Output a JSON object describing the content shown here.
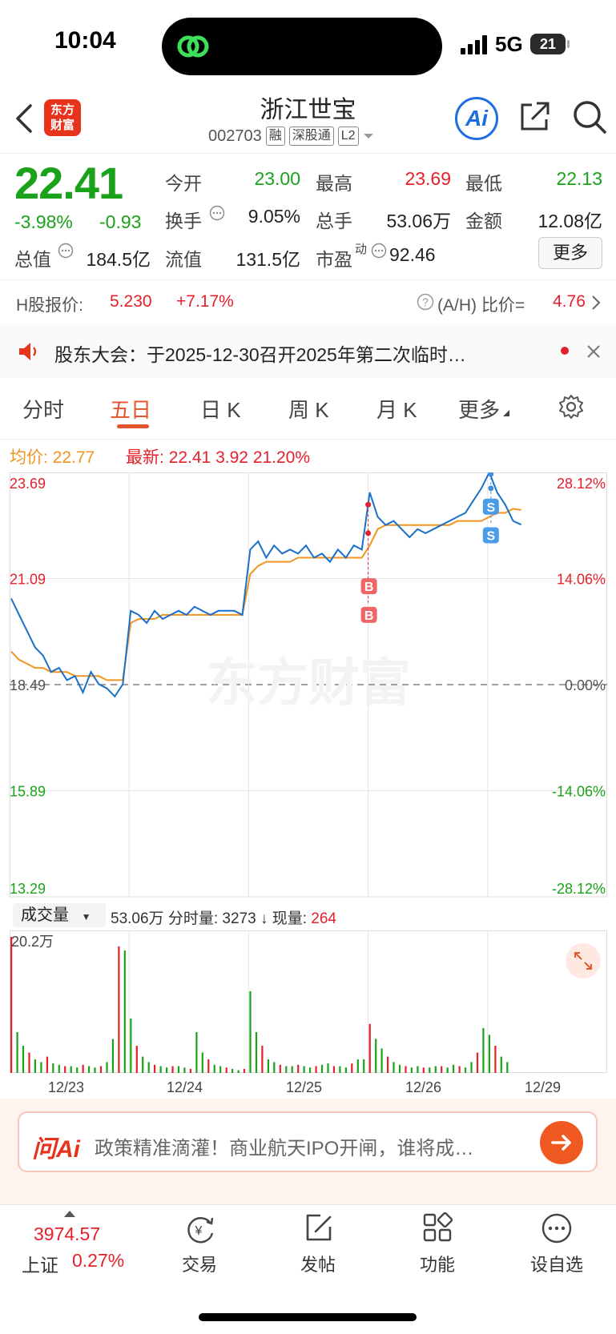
{
  "status_bar": {
    "time": "10:04",
    "network": "5G",
    "battery": "21"
  },
  "header": {
    "logo_text": "东方财富",
    "stock_name": "浙江世宝",
    "code": "002703",
    "tags": [
      "融",
      "深股通",
      "L2"
    ],
    "ai_label": "Ai"
  },
  "quote": {
    "price": "22.41",
    "change_pct": "-3.98%",
    "change_amt": "-0.93",
    "open_label": "今开",
    "open": "23.00",
    "high_label": "最高",
    "high": "23.69",
    "low_label": "最低",
    "low": "22.13",
    "turnover_label": "换手",
    "turnover": "9.05%",
    "volume_label": "总手",
    "volume": "53.06万",
    "amount_label": "金额",
    "amount": "12.08亿",
    "mcap_label": "总值",
    "mcap": "184.5亿",
    "float_label": "流值",
    "float": "131.5亿",
    "pe_label": "市盈",
    "pe_sup": "动",
    "pe": "92.46",
    "more_label": "更多"
  },
  "hshare": {
    "label": "H股报价:",
    "price": "5.230",
    "change": "+7.17%",
    "ah_label": "(A/H) 比价=",
    "ah_value": "4.76"
  },
  "notice": {
    "text": "股东大会：于2025-12-30召开2025年第二次临时…"
  },
  "tabs": [
    "分时",
    "五日",
    "日 K",
    "周 K",
    "月 K",
    "更多"
  ],
  "active_tab": "五日",
  "chart_info": {
    "avg_label": "均价:",
    "avg": "22.77",
    "latest_label": "最新:",
    "latest": "22.41",
    "latest_chg": "3.92",
    "latest_pct": "21.20%"
  },
  "chart_data": {
    "type": "line",
    "title": "",
    "left_axis": [
      "23.69",
      "21.09",
      "18.49",
      "15.89",
      "13.29"
    ],
    "right_axis": [
      "28.12%",
      "14.06%",
      "0.00%",
      "-14.06%",
      "-28.12%"
    ],
    "ylim": [
      13.29,
      23.69
    ],
    "base": 18.49,
    "days": [
      "12/23",
      "12/24",
      "12/25",
      "12/26",
      "12/29"
    ],
    "series": [
      {
        "name": "",
        "values": [
          20.6,
          20.2,
          19.8,
          19.4,
          19.2,
          18.8,
          18.9,
          18.6,
          18.7,
          18.3,
          18.8,
          18.5,
          18.4,
          18.2,
          18.5,
          20.3,
          20.2,
          20.0,
          20.3,
          20.1,
          20.2,
          20.3,
          20.2,
          20.4,
          20.3,
          20.2,
          20.3,
          20.3,
          20.3,
          20.2,
          21.8,
          22.0,
          21.6,
          21.9,
          21.7,
          21.8,
          21.7,
          21.9,
          21.6,
          21.7,
          21.5,
          21.8,
          21.6,
          21.9,
          21.8,
          23.2,
          22.6,
          22.4,
          22.5,
          22.3,
          22.1,
          22.3,
          22.2,
          22.3,
          22.4,
          22.5,
          22.6,
          22.7,
          23.0,
          23.3,
          23.69,
          23.2,
          22.9,
          22.5,
          22.41
        ]
      },
      {
        "name": "均价",
        "values": [
          19.3,
          19.1,
          19.0,
          18.9,
          18.9,
          18.8,
          18.8,
          18.8,
          18.7,
          18.7,
          18.7,
          18.7,
          18.6,
          18.6,
          18.6,
          20.0,
          20.1,
          20.1,
          20.1,
          20.2,
          20.2,
          20.2,
          20.2,
          20.2,
          20.2,
          20.2,
          20.2,
          20.2,
          20.2,
          20.2,
          21.2,
          21.4,
          21.5,
          21.5,
          21.5,
          21.5,
          21.6,
          21.6,
          21.6,
          21.6,
          21.6,
          21.6,
          21.6,
          21.6,
          21.6,
          21.9,
          22.3,
          22.4,
          22.4,
          22.4,
          22.4,
          22.4,
          22.4,
          22.4,
          22.4,
          22.4,
          22.5,
          22.5,
          22.5,
          22.5,
          22.6,
          22.7,
          22.7,
          22.8,
          22.77
        ]
      }
    ],
    "markers": [
      "B",
      "B",
      "S",
      "S"
    ]
  },
  "volume": {
    "selector": "成交量",
    "total": "53.06万",
    "tick_label": "分时量:",
    "tick_val": "3273",
    "now_label": "现量:",
    "now_val": "264",
    "max_label": "20.2万",
    "bars": [
      1.0,
      0.3,
      0.2,
      0.15,
      0.1,
      0.08,
      0.12,
      0.07,
      0.06,
      0.05,
      0.05,
      0.04,
      0.06,
      0.05,
      0.04,
      0.05,
      0.08,
      0.25,
      0.93,
      0.9,
      0.4,
      0.2,
      0.12,
      0.08,
      0.06,
      0.05,
      0.04,
      0.05,
      0.05,
      0.04,
      0.03,
      0.3,
      0.15,
      0.1,
      0.06,
      0.05,
      0.04,
      0.03,
      0.02,
      0.03,
      0.6,
      0.3,
      0.2,
      0.1,
      0.08,
      0.06,
      0.05,
      0.05,
      0.06,
      0.05,
      0.04,
      0.05,
      0.06,
      0.07,
      0.05,
      0.05,
      0.04,
      0.07,
      0.1,
      0.1,
      0.36,
      0.25,
      0.18,
      0.12,
      0.08,
      0.06,
      0.05,
      0.04,
      0.05,
      0.04,
      0.04,
      0.05,
      0.05,
      0.04,
      0.06,
      0.05,
      0.04,
      0.08,
      0.15,
      0.33,
      0.28,
      0.2,
      0.12,
      0.08
    ],
    "bar_colors": {
      "up": "#e5202b",
      "down": "#1aa21a"
    }
  },
  "ai_bar": {
    "logo": "问Ai",
    "text": "政策精准滴灌！商业航天IPO开闸，谁将成…"
  },
  "bottom_nav": {
    "index_value": "3974.57",
    "index_name": "上证",
    "index_pct": "0.27%",
    "items": [
      "交易",
      "发帖",
      "功能",
      "设自选"
    ]
  },
  "colors": {
    "up": "#e5202b",
    "down": "#1aa21a",
    "price_line": "#1a6fc9",
    "avg_line": "#f29420",
    "accent": "#e5532b"
  }
}
